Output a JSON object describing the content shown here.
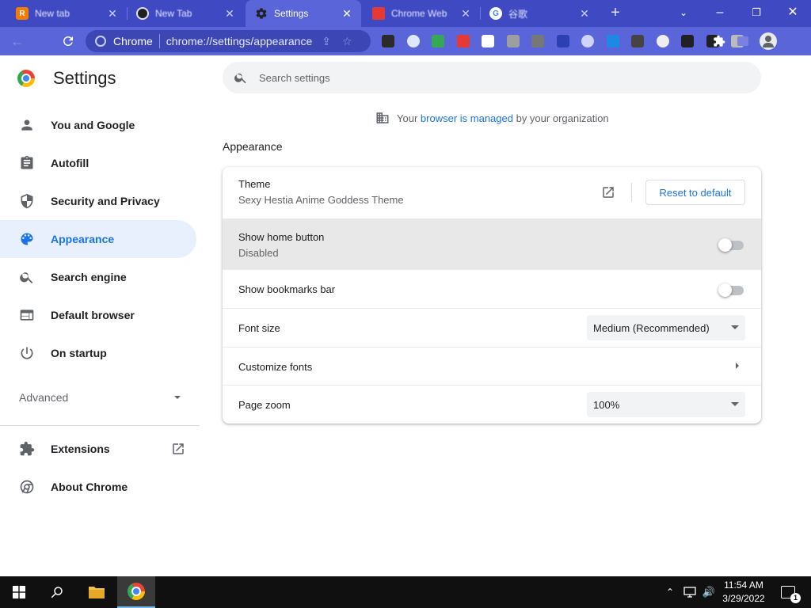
{
  "browser": {
    "tabs": [
      {
        "title": "New tab",
        "favicon_color": "#f57c00",
        "favicon_letter": "R",
        "active": false
      },
      {
        "title": "New Tab",
        "favicon_color": "#202124",
        "favicon_letter": "",
        "active": false
      },
      {
        "title": "Settings",
        "favicon_color": "",
        "favicon_letter": "",
        "active": true
      },
      {
        "title": "Chrome Web",
        "favicon_color": "#e53935",
        "favicon_letter": "",
        "active": false
      },
      {
        "title": "谷歌",
        "favicon_color": "#ffffff",
        "favicon_letter": "G",
        "active": false
      }
    ],
    "omnibox": {
      "site_label": "Chrome",
      "url": "chrome://settings/appearance"
    },
    "extensions": [
      "ext-1",
      "ext-2",
      "ext-3",
      "ext-4",
      "ext-5",
      "ext-6",
      "ext-7",
      "ext-8",
      "ext-9",
      "ext-10",
      "ext-11",
      "ext-12",
      "ext-13",
      "ext-14",
      "ext-15"
    ],
    "colors": {
      "frame": "#3f49c2",
      "toolbar": "#5965d9",
      "accent": "#1a73e8"
    }
  },
  "settings": {
    "title": "Settings",
    "search_placeholder": "Search settings",
    "managed_notice": {
      "prefix": "Your",
      "link": "browser is managed",
      "suffix": "by your organization"
    },
    "nav": [
      {
        "label": "You and Google",
        "icon": "person-icon"
      },
      {
        "label": "Autofill",
        "icon": "clipboard-icon"
      },
      {
        "label": "Security and Privacy",
        "icon": "shield-icon"
      },
      {
        "label": "Appearance",
        "icon": "palette-icon",
        "selected": true
      },
      {
        "label": "Search engine",
        "icon": "search-icon"
      },
      {
        "label": "Default browser",
        "icon": "browser-window-icon"
      },
      {
        "label": "On startup",
        "icon": "power-icon"
      }
    ],
    "advanced_label": "Advanced",
    "extensions_label": "Extensions",
    "about_label": "About Chrome",
    "section_title": "Appearance",
    "theme": {
      "label": "Theme",
      "value": "Sexy Hestia Anime Goddess Theme",
      "reset_label": "Reset to default"
    },
    "home_button": {
      "label": "Show home button",
      "status": "Disabled",
      "enabled": false
    },
    "bookmarks_bar": {
      "label": "Show bookmarks bar",
      "enabled": false
    },
    "font_size": {
      "label": "Font size",
      "value": "Medium (Recommended)"
    },
    "customize_fonts": {
      "label": "Customize fonts"
    },
    "page_zoom": {
      "label": "Page zoom",
      "value": "100%"
    }
  },
  "taskbar": {
    "time": "11:54 AM",
    "date": "3/29/2022",
    "notification_count": "1"
  }
}
